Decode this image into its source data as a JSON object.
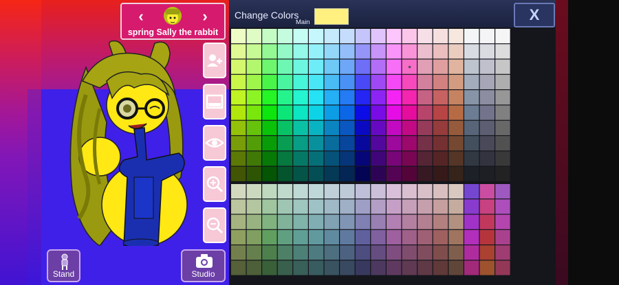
{
  "character_selector": {
    "name": "spring Sally the rabbit",
    "prev_icon": "chevron-left-icon",
    "next_icon": "chevron-right-icon"
  },
  "side_toolbar": [
    {
      "name": "add-character-icon"
    },
    {
      "name": "background-icon"
    },
    {
      "name": "eye-icon"
    },
    {
      "name": "zoom-in-icon"
    },
    {
      "name": "zoom-out-icon"
    }
  ],
  "bottom_buttons": {
    "stand_label": "Stand",
    "studio_label": "Studio"
  },
  "color_panel": {
    "title": "Change Colors",
    "target_label": "Main",
    "current_color": "#fff080",
    "close_label": "X"
  },
  "colors": {
    "scene_top": "#e8201c",
    "scene_bottom": "#4a18d8",
    "selector_bg": "#d61a6e",
    "panel_header": "#2a3358",
    "character_hair": "#9a9a10",
    "character_outfit": "#1a2fb0"
  }
}
